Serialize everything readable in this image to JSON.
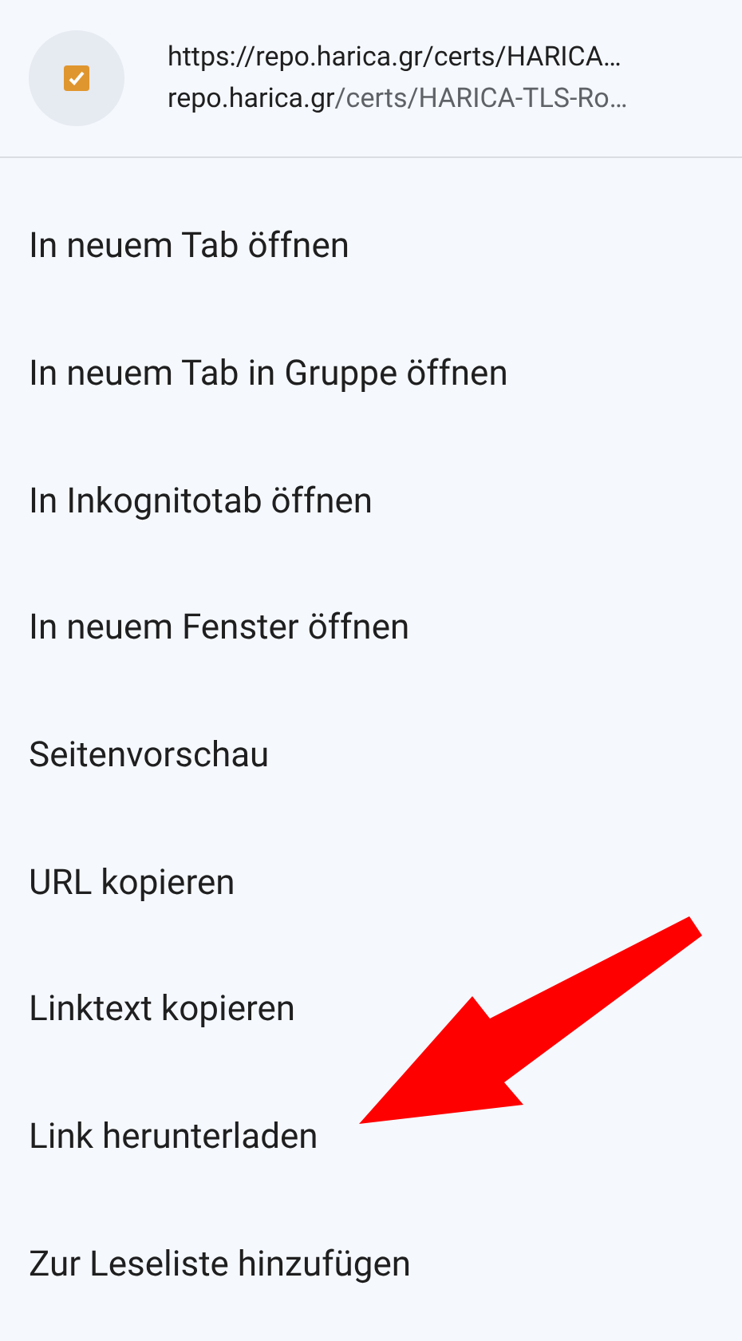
{
  "link_header": {
    "title": "https://repo.harica.gr/certs/HARICA…",
    "host": "repo.harica.gr",
    "path": "/certs/HARICA-TLS-Ro…"
  },
  "menu_items": [
    {
      "label": "In neuem Tab öffnen"
    },
    {
      "label": "In neuem Tab in Gruppe öffnen"
    },
    {
      "label": "In Inkognitotab öffnen"
    },
    {
      "label": "In neuem Fenster öffnen"
    },
    {
      "label": "Seitenvorschau"
    },
    {
      "label": "URL kopieren"
    },
    {
      "label": "Linktext kopieren"
    },
    {
      "label": "Link herunterladen"
    },
    {
      "label": "Zur Leseliste hinzufügen"
    }
  ]
}
